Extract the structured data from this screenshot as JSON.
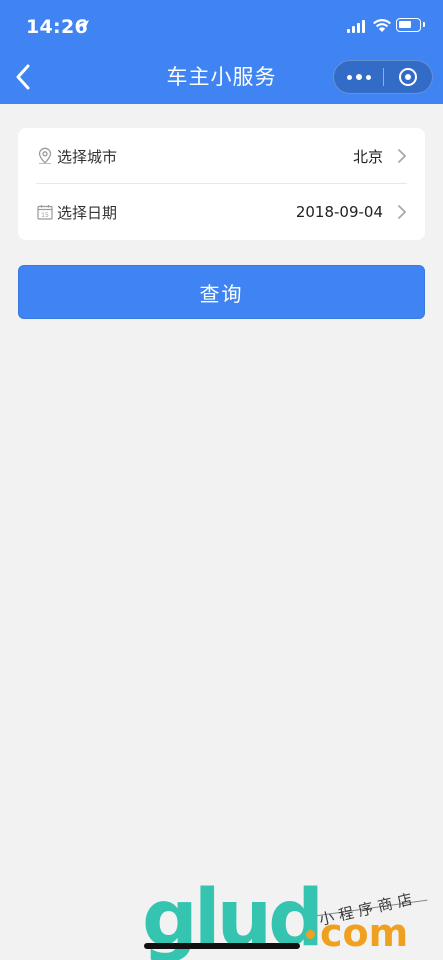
{
  "status_bar": {
    "time": "14:26"
  },
  "nav": {
    "title": "车主小服务"
  },
  "form": {
    "city_label": "选择城市",
    "city_value": "北京",
    "date_label": "选择日期",
    "date_value": "2018-09-04",
    "date_icon_text": "15"
  },
  "actions": {
    "query_label": "查询"
  },
  "watermark": {
    "brand": "glud",
    "tagline": "小程序商店",
    "domain": "com"
  },
  "colors": {
    "primary": "#3f84f2",
    "background": "#f2f2f2",
    "card": "#ffffff",
    "text": "#333333",
    "watermark_green": "#35c4b0",
    "watermark_orange": "#f0a020"
  },
  "icons": {
    "back": "chevron-left-icon",
    "more": "more-dots-icon",
    "close": "target-close-icon",
    "city": "location-pin-icon",
    "date": "calendar-icon",
    "row_arrow": "chevron-right-icon"
  }
}
